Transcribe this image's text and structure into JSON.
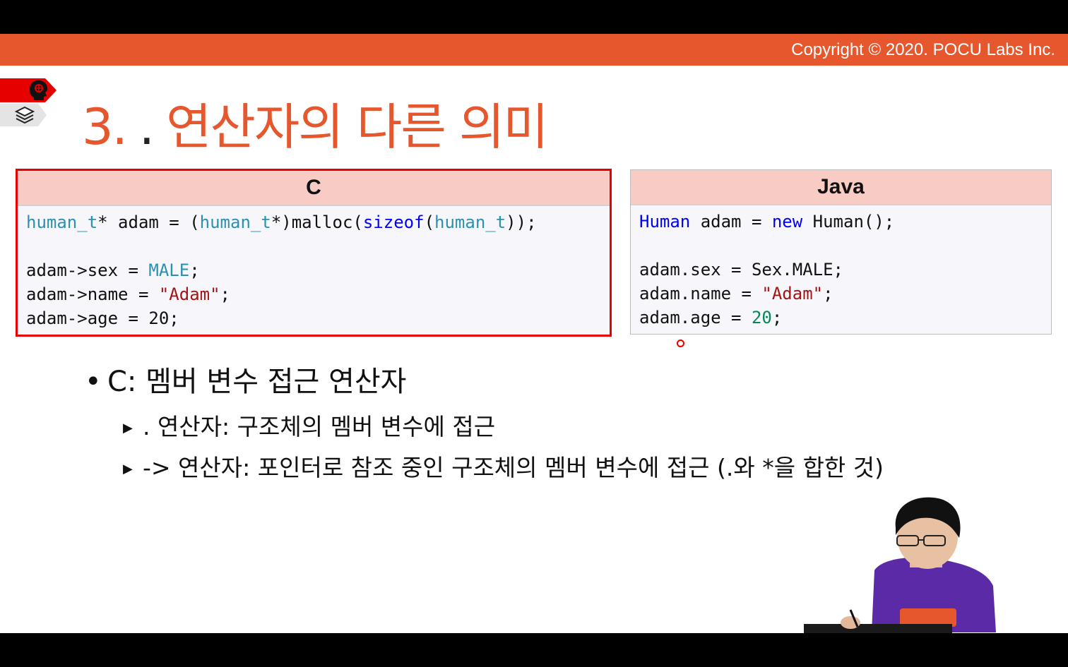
{
  "header": {
    "copyright": "Copyright © 2020. POCU Labs Inc."
  },
  "ribbon": {
    "top_icon": "brain-icon",
    "bottom_icon": "books-icon"
  },
  "title": {
    "number": "3.",
    "dot": ".",
    "text": "연산자의 다른 의미"
  },
  "panels": {
    "c": {
      "heading": "C",
      "lines": [
        [
          {
            "t": "human_t",
            "c": "ty"
          },
          {
            "t": "* adam = ("
          },
          {
            "t": "human_t",
            "c": "ty"
          },
          {
            "t": "*)malloc("
          },
          {
            "t": "sizeof",
            "c": "kw"
          },
          {
            "t": "("
          },
          {
            "t": "human_t",
            "c": "ty"
          },
          {
            "t": "));"
          }
        ],
        [],
        [
          {
            "t": "adam->sex = "
          },
          {
            "t": "MALE",
            "c": "ty"
          },
          {
            "t": ";"
          }
        ],
        [
          {
            "t": "adam->name = "
          },
          {
            "t": "\"Adam\"",
            "c": "str"
          },
          {
            "t": ";"
          }
        ],
        [
          {
            "t": "adam->age = 20;"
          }
        ]
      ]
    },
    "java": {
      "heading": "Java",
      "lines": [
        [
          {
            "t": "Human",
            "c": "kw"
          },
          {
            "t": " adam = "
          },
          {
            "t": "new",
            "c": "kw"
          },
          {
            "t": " Human();"
          }
        ],
        [],
        [
          {
            "t": "adam.sex = Sex.MALE;"
          }
        ],
        [
          {
            "t": "adam.name = "
          },
          {
            "t": "\"Adam\"",
            "c": "str"
          },
          {
            "t": ";"
          }
        ],
        [
          {
            "t": "adam.age = "
          },
          {
            "t": "20",
            "c": "num"
          },
          {
            "t": ";"
          }
        ]
      ]
    }
  },
  "bullets": {
    "main": "C: 멤버 변수 접근 연산자",
    "subs": [
      ". 연산자: 구조체의 멤버 변수에 접근",
      "-> 연산자: 포인터로 참조 중인 구조체의 멤버 변수에 접근 (.와 *을 합한 것)"
    ]
  },
  "colors": {
    "accent": "#e6572e",
    "selection": "#e60000",
    "panel_header": "#f8cbc4"
  }
}
